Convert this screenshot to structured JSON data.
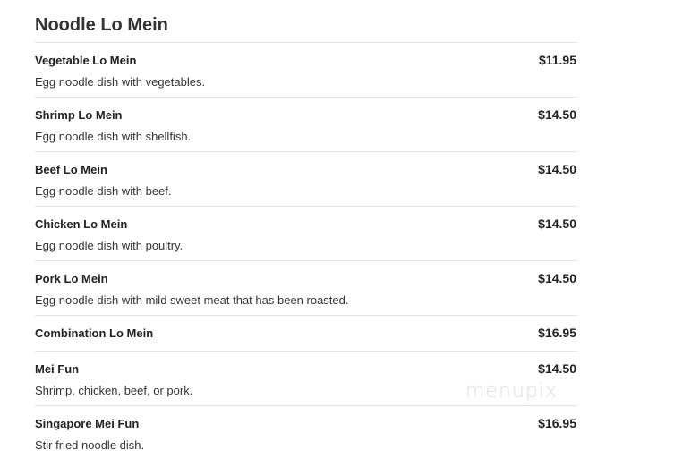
{
  "section": {
    "title": "Noodle Lo Mein"
  },
  "items": [
    {
      "name": "Vegetable Lo Mein",
      "price": "$11.95",
      "description": "Egg noodle dish with vegetables."
    },
    {
      "name": "Shrimp Lo Mein",
      "price": "$14.50",
      "description": "Egg noodle dish with shellfish."
    },
    {
      "name": "Beef Lo Mein",
      "price": "$14.50",
      "description": "Egg noodle dish with beef."
    },
    {
      "name": "Chicken Lo Mein",
      "price": "$14.50",
      "description": "Egg noodle dish with poultry."
    },
    {
      "name": "Pork Lo Mein",
      "price": "$14.50",
      "description": "Egg noodle dish with mild sweet meat that has been roasted."
    },
    {
      "name": "Combination Lo Mein",
      "price": "$16.95",
      "description": ""
    },
    {
      "name": "Mei Fun",
      "price": "$14.50",
      "description": "Shrimp, chicken, beef, or pork."
    },
    {
      "name": "Singapore Mei Fun",
      "price": "$16.95",
      "description": "Stir fried noodle dish."
    }
  ],
  "watermark": {
    "text": "menupix"
  }
}
